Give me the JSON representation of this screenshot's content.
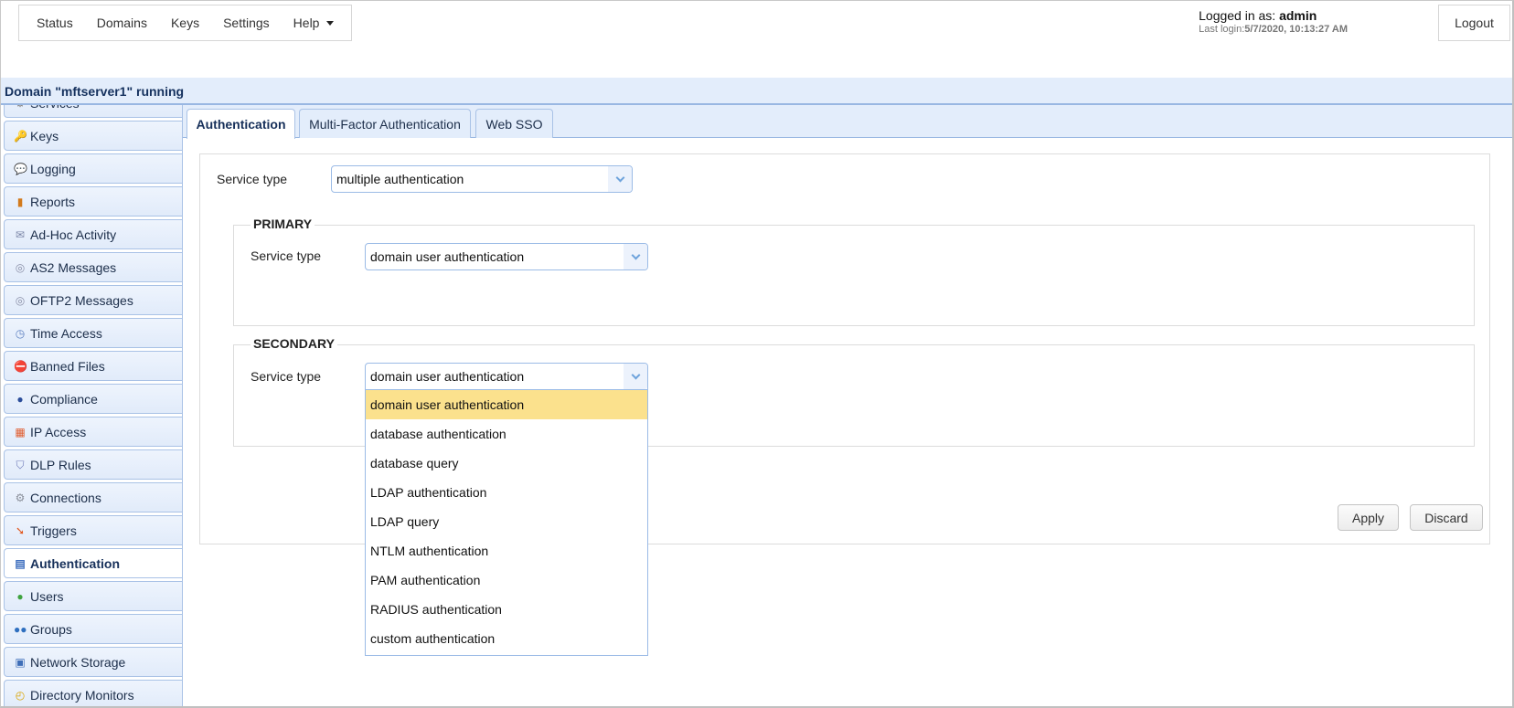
{
  "top_menu": {
    "items": [
      "Status",
      "Domains",
      "Keys",
      "Settings",
      "Help"
    ]
  },
  "login": {
    "prefix": "Logged in as: ",
    "user": "admin",
    "last_login_label": "Last login:",
    "last_login_value": "5/7/2020, 10:13:27 AM",
    "logout_label": "Logout"
  },
  "status_bar": {
    "text": "Domain \"mftserver1\" running"
  },
  "sidebar": {
    "items": [
      {
        "label": "Services",
        "icon": "services-icon"
      },
      {
        "label": "Keys",
        "icon": "key-icon"
      },
      {
        "label": "Logging",
        "icon": "speech-bubble-icon"
      },
      {
        "label": "Reports",
        "icon": "bar-chart-icon"
      },
      {
        "label": "Ad-Hoc Activity",
        "icon": "envelope-icon"
      },
      {
        "label": "AS2 Messages",
        "icon": "messages-icon"
      },
      {
        "label": "OFTP2 Messages",
        "icon": "messages-icon"
      },
      {
        "label": "Time Access",
        "icon": "calendar-clock-icon"
      },
      {
        "label": "Banned Files",
        "icon": "banned-file-icon"
      },
      {
        "label": "Compliance",
        "icon": "officer-icon"
      },
      {
        "label": "IP Access",
        "icon": "firewall-icon"
      },
      {
        "label": "DLP Rules",
        "icon": "shield-icon"
      },
      {
        "label": "Connections",
        "icon": "gear-connections-icon"
      },
      {
        "label": "Triggers",
        "icon": "trigger-arrow-icon"
      },
      {
        "label": "Authentication",
        "icon": "id-card-icon",
        "active": true
      },
      {
        "label": "Users",
        "icon": "user-icon"
      },
      {
        "label": "Groups",
        "icon": "group-icon"
      },
      {
        "label": "Network Storage",
        "icon": "network-storage-icon"
      },
      {
        "label": "Directory Monitors",
        "icon": "folder-monitor-icon"
      }
    ]
  },
  "tabs": [
    {
      "label": "Authentication",
      "active": true
    },
    {
      "label": "Multi-Factor Authentication"
    },
    {
      "label": "Web SSO"
    }
  ],
  "form": {
    "service_type_label": "Service type",
    "service_type_value": "multiple authentication",
    "primary": {
      "legend": "PRIMARY",
      "service_type_label": "Service type",
      "service_type_value": "domain user authentication"
    },
    "secondary": {
      "legend": "SECONDARY",
      "service_type_label": "Service type",
      "service_type_value": "domain user authentication",
      "dropdown_open": true,
      "options": [
        "domain user authentication",
        "database authentication",
        "database query",
        "LDAP authentication",
        "LDAP query",
        "NTLM authentication",
        "PAM authentication",
        "RADIUS authentication",
        "custom authentication"
      ],
      "highlighted_option": "domain user authentication"
    },
    "apply_label": "Apply",
    "discard_label": "Discard"
  },
  "colors": {
    "accent_bg": "#e3edfb",
    "accent_border": "#99b7e2",
    "highlight": "#fbe18d",
    "title_text": "#15315e"
  }
}
